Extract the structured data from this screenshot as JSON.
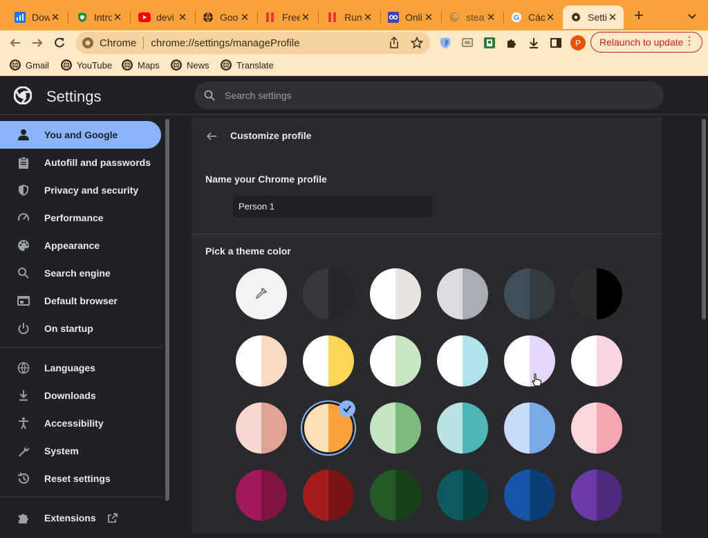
{
  "tabs": [
    {
      "title": "Dow",
      "icon": "chart-favicon"
    },
    {
      "title": "Intro",
      "icon": "shield-favicon"
    },
    {
      "title": "devi",
      "icon": "youtube-favicon"
    },
    {
      "title": "Goo",
      "icon": "globe-favicon"
    },
    {
      "title": "Free",
      "icon": "bars-favicon"
    },
    {
      "title": "Run",
      "icon": "bars-favicon"
    },
    {
      "title": "Onli",
      "icon": "circuit-favicon"
    },
    {
      "title": "stea",
      "icon": "steam-favicon"
    },
    {
      "title": "Các",
      "icon": "google-favicon"
    },
    {
      "title": "Setti",
      "icon": "gear-favicon",
      "active": true
    }
  ],
  "toolbar": {
    "site_label": "Chrome",
    "url": "chrome://settings/manageProfile",
    "profile_initial": "P",
    "relaunch_label": "Relaunch to update"
  },
  "bookmarks": [
    "Gmail",
    "YouTube",
    "Maps",
    "News",
    "Translate"
  ],
  "header": {
    "title": "Settings",
    "search_placeholder": "Search settings"
  },
  "sidebar": {
    "items": [
      {
        "label": "You and Google",
        "icon": "person-icon",
        "active": true
      },
      {
        "label": "Autofill and passwords",
        "icon": "clipboard-icon"
      },
      {
        "label": "Privacy and security",
        "icon": "shield-icon"
      },
      {
        "label": "Performance",
        "icon": "speedometer-icon"
      },
      {
        "label": "Appearance",
        "icon": "palette-icon"
      },
      {
        "label": "Search engine",
        "icon": "search-icon"
      },
      {
        "label": "Default browser",
        "icon": "browser-icon"
      },
      {
        "label": "On startup",
        "icon": "power-icon"
      },
      {
        "label": "Languages",
        "icon": "globe-icon"
      },
      {
        "label": "Downloads",
        "icon": "download-icon"
      },
      {
        "label": "Accessibility",
        "icon": "accessibility-icon"
      },
      {
        "label": "System",
        "icon": "wrench-icon"
      },
      {
        "label": "Reset settings",
        "icon": "history-icon"
      },
      {
        "label": "Extensions",
        "icon": "puzzle-icon"
      }
    ]
  },
  "main": {
    "page_title": "Customize profile",
    "name_label": "Name your Chrome profile",
    "name_value": "Person 1",
    "theme_label": "Pick a theme color",
    "theme_colors": [
      [
        [
          "#f1f3f4",
          "#f1f3f4"
        ],
        [
          "#36373a",
          "#26272a"
        ],
        [
          "#ffffff",
          "#e8e4e0"
        ],
        [
          "#dadce0",
          "#a8acb4"
        ],
        [
          "#40505a",
          "#303b42"
        ],
        [
          "#2e2e2e",
          "#000000"
        ]
      ],
      [
        [
          "#ffffff",
          "#fcd9c4"
        ],
        [
          "#ffffff",
          "#fcd553"
        ],
        [
          "#ffffff",
          "#c8e6c0"
        ],
        [
          "#ffffff",
          "#b0e3ec"
        ],
        [
          "#ffffff",
          "#e6d6fd"
        ],
        [
          "#ffffff",
          "#f6d6e2"
        ]
      ],
      [
        [
          "#f5d9d0",
          "#e0a494"
        ],
        [
          "#fde0b4",
          "#f9a23c"
        ],
        [
          "#c4e4c2",
          "#7cbc7a"
        ],
        [
          "#b6e2e2",
          "#4fb4b8"
        ],
        [
          "#c8dcf8",
          "#7aa8e8"
        ],
        [
          "#fcd8dc",
          "#f6a4b0"
        ]
      ],
      [
        [
          "#a21a5c",
          "#7e1444"
        ],
        [
          "#a51c1c",
          "#7a1414"
        ],
        [
          "#245a24",
          "#1a401a"
        ],
        [
          "#0a5a5e",
          "#074244"
        ],
        [
          "#1456a8",
          "#0e3e7a"
        ],
        [
          "#6c3ba8",
          "#4e2a7e"
        ]
      ]
    ],
    "selected_color": [
      2,
      1
    ]
  }
}
